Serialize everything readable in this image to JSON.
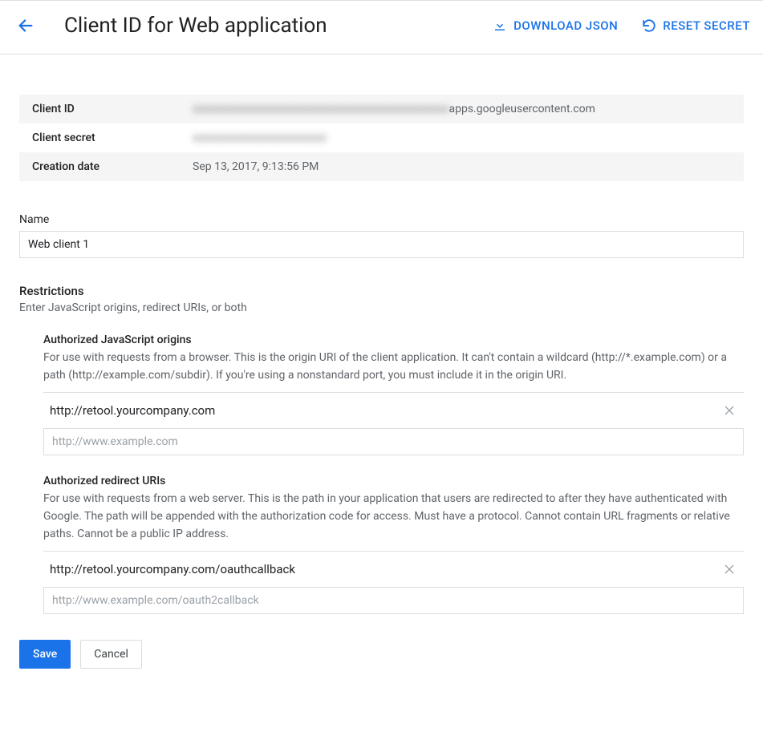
{
  "header": {
    "title": "Client ID for Web application",
    "download_label": "DOWNLOAD JSON",
    "reset_label": "RESET SECRET"
  },
  "info": {
    "client_id_label": "Client ID",
    "client_id_value_masked": "xxxxxxxxxxxxxxxxxxxxxxxxxxxxxxxxxxxxxxxxxxxxxx",
    "client_id_value_suffix": "apps.googleusercontent.com",
    "client_secret_label": "Client secret",
    "client_secret_value_masked": "xxxxxxxxxxxxxxxxxxxxxxxx",
    "creation_label": "Creation date",
    "creation_value": "Sep 13, 2017, 9:13:56 PM"
  },
  "name": {
    "label": "Name",
    "value": "Web client 1"
  },
  "restrictions": {
    "title": "Restrictions",
    "subtitle": "Enter JavaScript origins, redirect URIs, or both",
    "js_origins": {
      "title": "Authorized JavaScript origins",
      "description": "For use with requests from a browser. This is the origin URI of the client application. It can't contain a wildcard (http://*.example.com) or a path (http://example.com/subdir). If you're using a nonstandard port, you must include it in the origin URI.",
      "entries": [
        "http://retool.yourcompany.com"
      ],
      "placeholder": "http://www.example.com"
    },
    "redirect_uris": {
      "title": "Authorized redirect URIs",
      "description": "For use with requests from a web server. This is the path in your application that users are redirected to after they have authenticated with Google. The path will be appended with the authorization code for access. Must have a protocol. Cannot contain URL fragments or relative paths. Cannot be a public IP address.",
      "entries": [
        "http://retool.yourcompany.com/oauthcallback"
      ],
      "placeholder": "http://www.example.com/oauth2callback"
    }
  },
  "buttons": {
    "save": "Save",
    "cancel": "Cancel"
  }
}
